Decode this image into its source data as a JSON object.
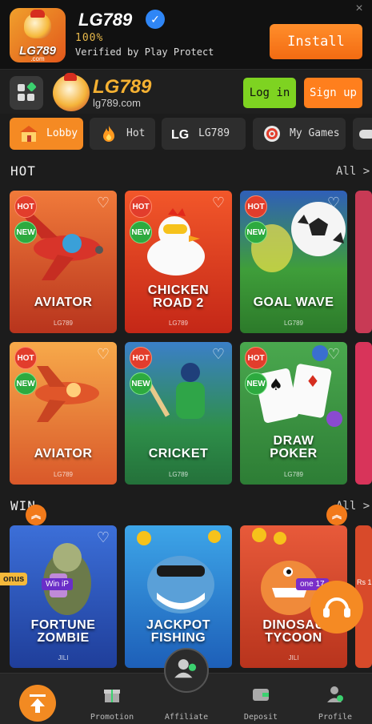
{
  "banner": {
    "app_name": "LG789",
    "icon_text": "LG789",
    "icon_sub": ".com",
    "rating": "100%",
    "subtitle": "Verified by Play Protect",
    "install_label": "Install",
    "close_label": "×"
  },
  "header": {
    "brand_name": "LG789",
    "brand_url": "lg789.com",
    "login_label": "Log in",
    "signup_label": "Sign up"
  },
  "tabs": [
    {
      "label": "Lobby",
      "active": true
    },
    {
      "label": "Hot",
      "active": false
    },
    {
      "label": "LG789",
      "active": false
    },
    {
      "label": "My Games",
      "active": false
    }
  ],
  "hot_section": {
    "title": "HOT",
    "all_label": "All >",
    "games": [
      {
        "line1": "AVIATOR",
        "line2": "",
        "provider": "LG789",
        "hot": "HOT",
        "new": "NEW"
      },
      {
        "line1": "CHICKEN",
        "line2": "ROAD 2",
        "provider": "LG789",
        "hot": "HOT",
        "new": "NEW"
      },
      {
        "line1": "GOAL WAVE",
        "line2": "",
        "provider": "LG789",
        "hot": "HOT",
        "new": "NEW"
      },
      {
        "line1": "AVIATOR",
        "line2": "",
        "provider": "LG789",
        "hot": "HOT",
        "new": "NEW"
      },
      {
        "line1": "CRICKET",
        "line2": "",
        "provider": "LG789",
        "hot": "HOT",
        "new": "NEW"
      },
      {
        "line1": "DRAW",
        "line2": "POKER",
        "provider": "LG789",
        "hot": "HOT",
        "new": "NEW"
      }
    ]
  },
  "win_section": {
    "title": "WIN",
    "all_label": "All >",
    "games": [
      {
        "line1": "FORTUNE",
        "line2": "ZOMBIE",
        "provider": "JILI",
        "tag": "Win iP"
      },
      {
        "line1": "JACKPOT",
        "line2": "FISHING",
        "provider": "JILI",
        "tag": ""
      },
      {
        "line1": "DINOSAU",
        "line2": "TYCOON",
        "provider": "JILI",
        "tag": "one 17"
      }
    ],
    "side_tag_left": "onus",
    "side_tag_right": "Rs 1"
  },
  "bottom_nav": [
    {
      "label": ""
    },
    {
      "label": "Promotion"
    },
    {
      "label": "Affiliate"
    },
    {
      "label": "Deposit"
    },
    {
      "label": "Profile"
    }
  ],
  "colors": {
    "accent": "#f58a23",
    "login": "#7ed321",
    "background": "#1c1c1c"
  }
}
